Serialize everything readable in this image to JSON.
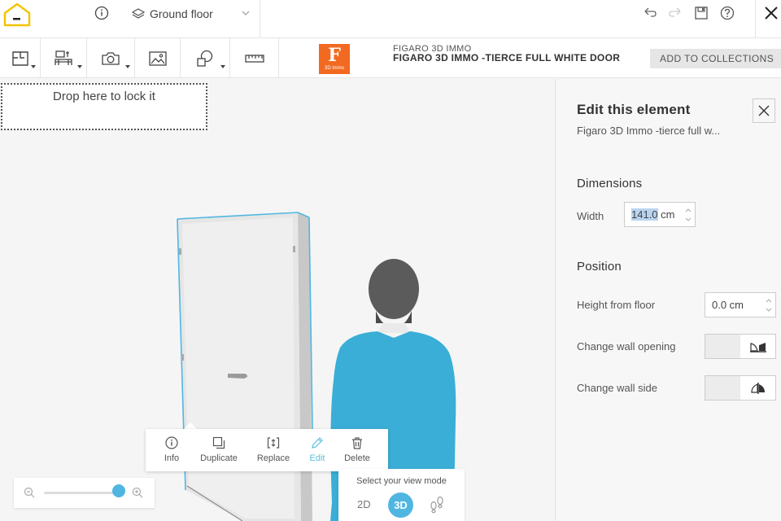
{
  "header": {
    "floor_label": "Ground floor"
  },
  "product": {
    "brand_logo_letter": "F",
    "brand_logo_sub": "3D immo",
    "brand": "FIGARO 3D IMMO",
    "name": "FIGARO 3D IMMO -TIERCE FULL WHITE DOOR",
    "add_button": "ADD TO COLLECTIONS"
  },
  "canvas": {
    "drop_zone": "Drop here to lock it"
  },
  "context_menu": {
    "items": [
      {
        "label": "Info",
        "icon": "info-icon"
      },
      {
        "label": "Duplicate",
        "icon": "duplicate-icon"
      },
      {
        "label": "Replace",
        "icon": "replace-icon"
      },
      {
        "label": "Edit",
        "icon": "pencil-icon",
        "active": true
      },
      {
        "label": "Delete",
        "icon": "trash-icon"
      }
    ]
  },
  "zoom": {
    "level": 0.96
  },
  "view_mode": {
    "title": "Select your view mode",
    "mode_2d": "2D",
    "mode_3d": "3D",
    "active": "3D"
  },
  "panel": {
    "title": "Edit this element",
    "subtitle": "Figaro 3D Immo -tierce full w...",
    "dimensions_title": "Dimensions",
    "width_label": "Width",
    "width_value": "141.0",
    "width_unit": "cm",
    "position_title": "Position",
    "height_label": "Height from floor",
    "height_value": "0.0 cm",
    "wall_opening_label": "Change wall opening",
    "wall_side_label": "Change wall side"
  },
  "colors": {
    "accent": "#4fb6e2",
    "brand_orange": "#f26a21",
    "logo_yellow": "#f5c400"
  }
}
